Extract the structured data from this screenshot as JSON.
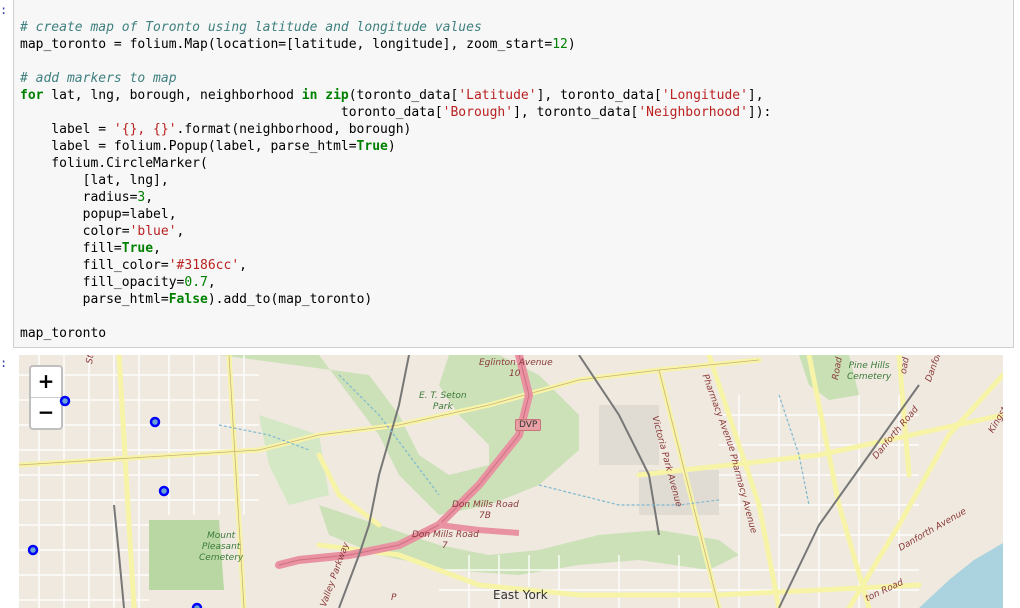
{
  "cells": {
    "code_prompt": ":",
    "output_prompt": ":"
  },
  "code": {
    "c1": "# create map of Toronto using latitude and longitude values",
    "l2a": "map_toronto = folium.Map(location=[latitude, longitude], zoom_start=",
    "l2n": "12",
    "l2b": ")",
    "c4": "# add markers to map",
    "l5kw": "for",
    "l5a": " lat, lng, borough, neighborhood ",
    "l5in": "in",
    "l5b": " ",
    "l5zip": "zip",
    "l5c": "(toronto_data[",
    "l5s1": "'Latitude'",
    "l5d": "], toronto_data[",
    "l5s2": "'Longitude'",
    "l5e": "],",
    "l6a": "                                         toronto_data[",
    "l6s1": "'Borough'",
    "l6b": "], toronto_data[",
    "l6s2": "'Neighborhood'",
    "l6c": "]):",
    "l7a": "    label = ",
    "l7s": "'{}, {}'",
    "l7b": ".format(neighborhood, borough)",
    "l8a": "    label = folium.Popup(label, parse_html=",
    "l8t": "True",
    "l8b": ")",
    "l9": "    folium.CircleMarker(",
    "l10": "        [lat, lng],",
    "l11a": "        radius=",
    "l11n": "3",
    "l11b": ",",
    "l12": "        popup=label,",
    "l13a": "        color=",
    "l13s": "'blue'",
    "l13b": ",",
    "l14a": "        fill=",
    "l14t": "True",
    "l14b": ",",
    "l15a": "        fill_color=",
    "l15s": "'#3186cc'",
    "l15b": ",",
    "l16a": "        fill_opacity=",
    "l16n": "0.7",
    "l16b": ",",
    "l17a": "        parse_html=",
    "l17f": "False",
    "l17b": ").add_to(map_toronto)",
    "l19": "map_toronto"
  },
  "map": {
    "zoom_in": "+",
    "zoom_out": "−",
    "labels": {
      "eglinton": "Eglinton Avenue",
      "eglinton_num": "10",
      "seton": "E. T. Seton\nPark",
      "dvp": "DVP",
      "pine_hills": "Pine Hills\nCemetery",
      "mount_pleasant": "Mount\nPleasant\nCemetery",
      "don_mills_1": "Don Mills Road",
      "don_mills_1_num": "7B",
      "don_mills_2": "Don Mills Road",
      "don_mills_2_num": "7",
      "east_york": "East York",
      "victoria_park": "Victoria Park Avenue",
      "pharmacy_1": "Pharmacy Avenue",
      "pharmacy_2": "Pharmacy Avenue",
      "danforth_1": "Danforth Road",
      "danforth_2": "Danforth Avenue",
      "danforth_top": "Danforth",
      "kingston": "Kingston",
      "street": "Street",
      "road_top": "Road",
      "road_top2": "oad",
      "valley_parkway": "Valley Parkway",
      "bottom_p": "P",
      "bottom_ton": "ton Road"
    },
    "marker_color": "#0000ff",
    "marker_fill": "#3186cc",
    "water_color": "#aad3df",
    "park_color": "#c8e0b4"
  }
}
